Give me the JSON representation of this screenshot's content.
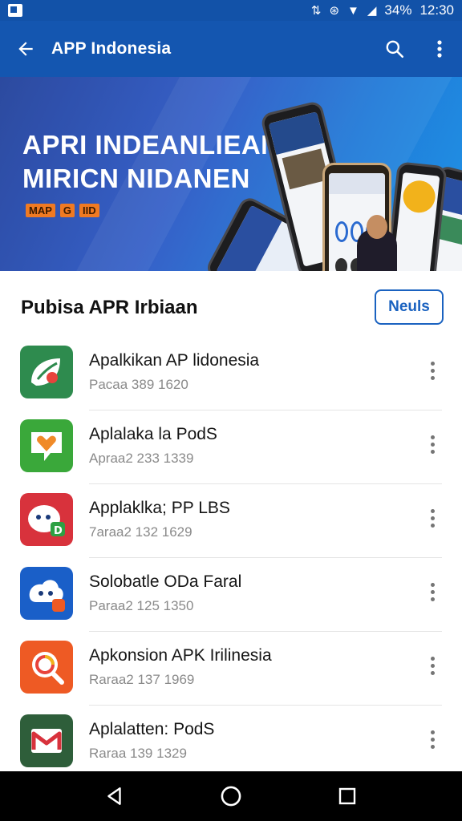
{
  "status": {
    "battery": "34%",
    "time": "12:30"
  },
  "appbar": {
    "title": "APP Indonesia"
  },
  "banner": {
    "line1": "APRI INDEANLIEAN",
    "line2": "MIRICN NIDANEN",
    "tags": [
      "MAP",
      "G",
      "IID"
    ]
  },
  "section": {
    "title": "Pubisa APR Irbiaan",
    "more_label": "Neuls"
  },
  "apps": [
    {
      "name": "Apalkikan AP lidonesia",
      "meta": "Pacaa 389 1620",
      "color": "#2e8b4e",
      "icon": "leaf-app-icon"
    },
    {
      "name": "Aplalaka la PodS",
      "meta": "Apraa2 233 1339",
      "color": "#3aa83a",
      "icon": "heart-app-icon"
    },
    {
      "name": "Applaklka; PP LBS",
      "meta": "7araa2 132 1629",
      "color": "#d8323c",
      "icon": "face-app-icon"
    },
    {
      "name": "Solobatle ODa Faral",
      "meta": "Paraa2 125 1350",
      "color": "#1a5fc8",
      "icon": "cloud-app-icon"
    },
    {
      "name": "Apkonsion APK Irilinesia",
      "meta": "Raraa2 137 1969",
      "color": "#ee5a24",
      "icon": "search-app-icon"
    },
    {
      "name": "Aplalatten: PodS",
      "meta": "Raraa 139 1329",
      "color": "#2e5e3a",
      "icon": "mail-app-icon"
    }
  ]
}
